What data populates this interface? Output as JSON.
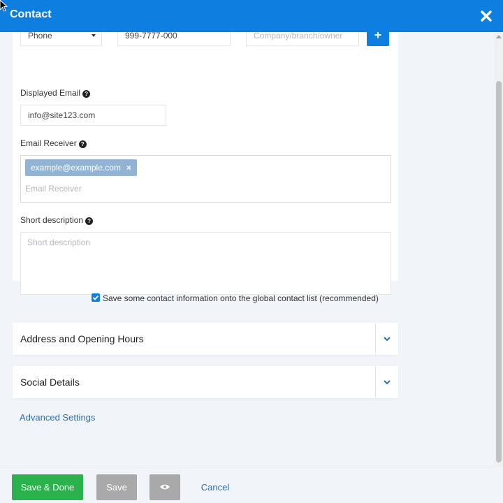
{
  "header": {
    "title": "Contact"
  },
  "phone_row": {
    "type_value": "Phone",
    "number_value": "999-7777-000",
    "company_placeholder": "Company/branch/owner",
    "add_label": "+"
  },
  "displayed_email": {
    "label": "Displayed Email",
    "value": "info@site123.com",
    "help": "?"
  },
  "email_receiver": {
    "label": "Email Receiver",
    "help": "?",
    "tag": "example@example.com",
    "tag_remove": "×",
    "placeholder": "Email Receiver"
  },
  "short_description": {
    "label": "Short description",
    "help": "?",
    "placeholder": "Short description"
  },
  "save_global": {
    "label": "Save some contact information onto the global contact list (recommended)",
    "checked": true
  },
  "sections": [
    {
      "label": "Address and Opening Hours"
    },
    {
      "label": "Social Details"
    }
  ],
  "advanced_label": "Advanced Settings",
  "footer": {
    "save_done_label": "Save & Done",
    "save_label": "Save",
    "cancel_label": "Cancel"
  },
  "colors": {
    "header": "#0e7fe0",
    "save_done": "#2bb24c",
    "disabled_button": "#a9a9a9",
    "link": "#2a6fb5",
    "tag": "#92b4d4"
  }
}
